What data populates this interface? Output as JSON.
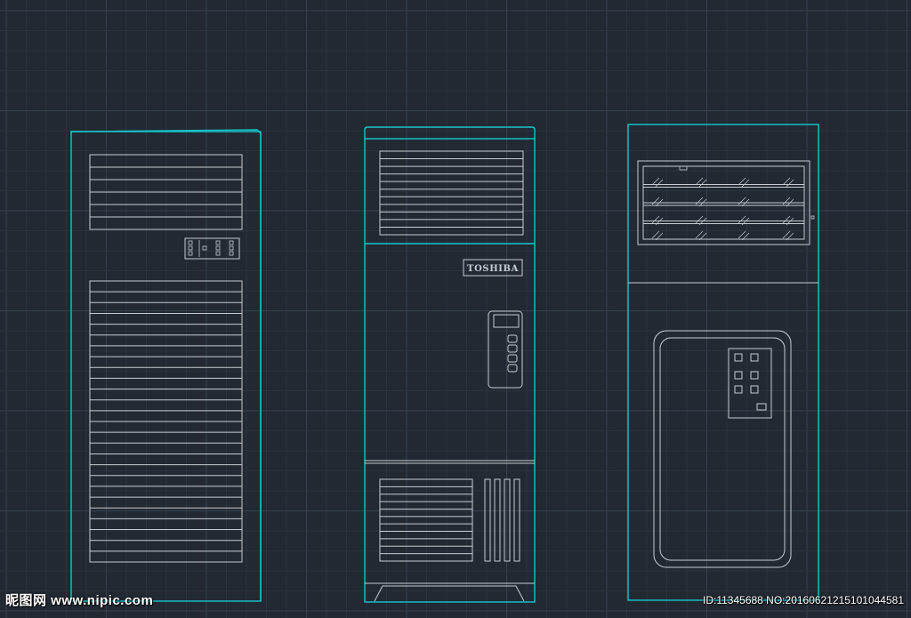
{
  "drawing": {
    "background_color": "#222933",
    "grid_minor_color": "#2b333e",
    "grid_major_color": "#36414f",
    "outline_color": "#17c6cc",
    "detail_color": "#c8ccd2"
  },
  "units": [
    {
      "name": "Floor air conditioner, front elevation A",
      "kind": "louvered-column",
      "upper_louver_slats": 6,
      "control_panel_buttons": 9,
      "lower_louver_slats": 26
    },
    {
      "name": "Floor air conditioner, front elevation B",
      "kind": "branded-column",
      "brand_label": "TOSHIBA",
      "top_louver_slats": 11,
      "remote_buttons": 4,
      "bottom_grille_slats": 11,
      "bottom_vertical_slots": 4
    },
    {
      "name": "Floor air conditioner, front elevation C",
      "kind": "panel-column",
      "grille_rows": 4,
      "panel_buttons": 7
    }
  ],
  "watermark": {
    "brand": "昵图网 www.nipic.com",
    "id_text": "ID:11345688 NO:20160621215101044581"
  }
}
